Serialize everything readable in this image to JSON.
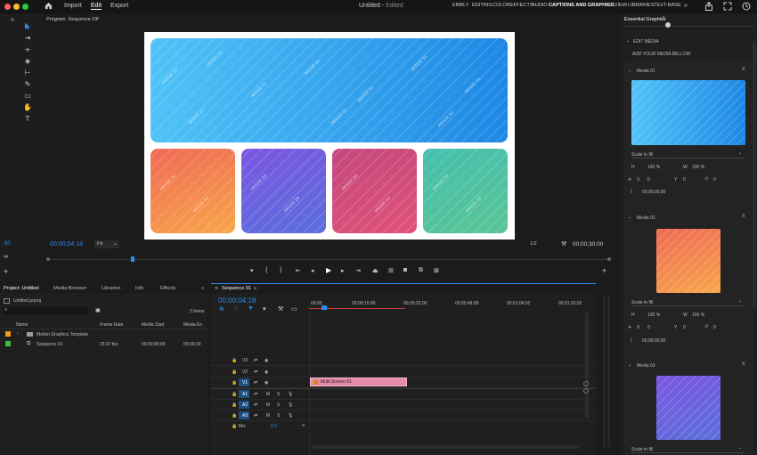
{
  "menu": {
    "import": "Import",
    "edit": "Edit",
    "export": "Export",
    "title": "Untitled",
    "title_sep": " - ",
    "status": "Edited"
  },
  "workspaces": [
    "EMBLY",
    "EDITING",
    "COLOR",
    "EFFECTS",
    "AUDIO",
    "CAPTIONS AND GRAPHICS",
    "REVIEW",
    "LIBRARIES",
    "TEXT-BASE"
  ],
  "colors": {
    "accent": "#2d8ceb",
    "clip": "#e58aa8",
    "top_card_from": "#4fc3f7",
    "top_card_to": "#1e88e5",
    "card2_from": "#f27157",
    "card2_to": "#f7a14a",
    "card3_from": "#7a5de0",
    "card3_to": "#5b67d9",
    "card4_from": "#c94a7a",
    "card4_to": "#e0527a",
    "card5_from": "#48c2a7",
    "card5_to": "#57c49a"
  },
  "program": {
    "tab": "Program: Sequence 01",
    "timecode": "00;00;04;18",
    "fit": "Fit",
    "resolution": "1/2",
    "duration": "00;00;30;00",
    "zoom_value": "80",
    "watermarks": {
      "top": "IMAGE 01",
      "c2": "IMAGE 02",
      "c3": "IMAGE 03",
      "c4": "IMAGE 04",
      "c5": "IMAGE 05"
    }
  },
  "project": {
    "tabs": [
      "Project: Untitled",
      "Media Browser",
      "Libraries",
      "Info",
      "Effects"
    ],
    "file": "Untitled.prproj",
    "items_count": "2 Items",
    "columns": [
      "Name",
      "Frame Rate",
      "Media Start",
      "Media En"
    ],
    "rows": [
      {
        "name": "Motion Graphics Template",
        "fps": "",
        "start": "",
        "end": ""
      },
      {
        "name": "Sequence 01",
        "fps": "29.97 fps",
        "start": "00;00;00;00",
        "end": "00;00;29"
      }
    ]
  },
  "timeline": {
    "tab": "Sequence 01",
    "timecode": "00;00;04;18",
    "ruler": [
      "00;00",
      "00;00;15;00",
      "00;00;32;00",
      "00;00;48;00",
      "00;01;04;02",
      "00;01;20;02"
    ],
    "tracks": [
      "V3",
      "V2",
      "V1",
      "A1",
      "A2",
      "A3"
    ],
    "mix_label": "Mix",
    "mix_value": "0.0",
    "clip_name": "Multi Screen 01"
  },
  "essential": {
    "title": "Essential Graphics",
    "section": "EDIT MEDIA",
    "hint": "ADD YOUR MEDIA BELLOW",
    "media": [
      {
        "label": "Media 01",
        "scale": "Scale to fill",
        "h": "100 %",
        "w": "100 %",
        "x": "0",
        "y": "0",
        "time": "00;00;00;00"
      },
      {
        "label": "Media 02",
        "scale": "Scale to fill",
        "h": "100 %",
        "w": "100 %",
        "x": "0",
        "y": "0",
        "time": "00;00;00;00"
      },
      {
        "label": "Media 03",
        "scale": "Scale to fill"
      }
    ],
    "letters": {
      "h": "H",
      "w": "W",
      "x": "X",
      "y": "Y"
    }
  }
}
